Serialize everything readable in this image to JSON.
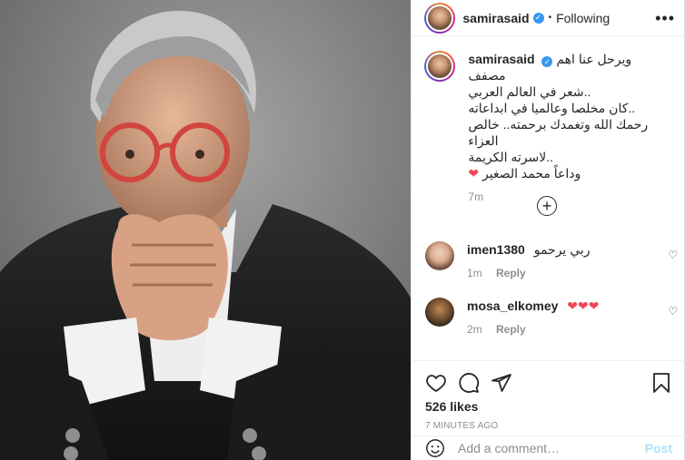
{
  "header": {
    "username": "samirasaid",
    "separator": "•",
    "follow_status": "Following",
    "more": "•••"
  },
  "caption": {
    "username": "samirasaid",
    "lines": [
      "ويرحل عنا اهم مصفف",
      "..شعر في العالم العربي",
      "..كان مخلصا وعالميا في ابداعاته",
      "رحمك الله وتغمدك برحمته.. خالص العزاء",
      "..لاسرته الكريمة",
      "وداعاً محمد الصغير"
    ],
    "heart": "❤",
    "timestamp": "7m"
  },
  "load_more": "+",
  "comments": [
    {
      "username": "imen1380",
      "text": "ربي يرحمو",
      "time": "1m",
      "reply": "Reply"
    },
    {
      "username": "mosa_elkomey",
      "text": "❤❤❤",
      "time": "2m",
      "reply": "Reply"
    }
  ],
  "actions": {
    "likes": "526 likes",
    "age": "7 MINUTES AGO"
  },
  "add_comment": {
    "placeholder": "Add a comment…",
    "post_label": "Post"
  },
  "colors": {
    "verified": "#3897f0",
    "heart": "#ed4956",
    "post_disabled": "#b2dffc"
  },
  "icons": [
    "verified-icon",
    "more-icon",
    "heart-icon",
    "comment-icon",
    "share-icon",
    "bookmark-icon",
    "emoji-icon",
    "plus-circle-icon"
  ]
}
